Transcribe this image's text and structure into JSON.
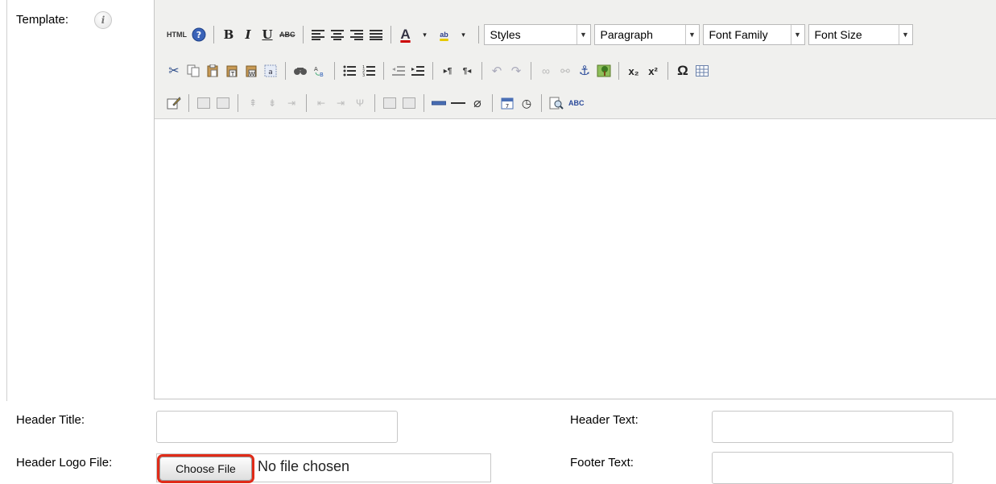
{
  "form": {
    "template_label": "Template:",
    "template_info_icon": "i",
    "header_title_label": "Header Title:",
    "header_title_value": "",
    "header_text_label": "Header Text:",
    "header_text_value": "",
    "header_logo_label": "Header Logo File:",
    "choose_file_label": "Choose File",
    "file_status": "No file chosen",
    "footer_text_label": "Footer Text:",
    "footer_text_value": ""
  },
  "editor": {
    "html_label": "HTML",
    "bold_label": "B",
    "italic_label": "I",
    "underline_label": "U",
    "strike_label": "ABC",
    "font_color_label": "A",
    "highlight_label": "ab",
    "styles_select": "Styles",
    "format_select": "Paragraph",
    "font_family_select": "Font Family",
    "font_size_select": "Font Size",
    "subscript_label": "x₂",
    "superscript_label": "x²",
    "special_char_label": "Ω",
    "spellcheck_label": "ABC"
  },
  "colors": {
    "highlight_border": "#e02b18",
    "toolbar_bg": "#f0f0ee"
  }
}
